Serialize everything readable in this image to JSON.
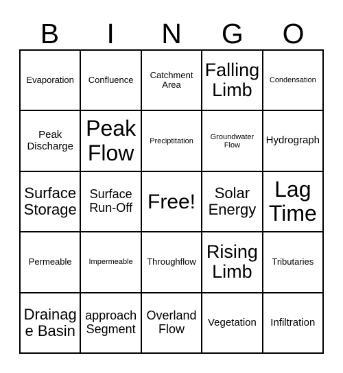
{
  "card": {
    "title": "BINGO",
    "header_letters": [
      "B",
      "I",
      "N",
      "G",
      "O"
    ],
    "columns": 5,
    "rows": 5,
    "colors": {
      "background": "#ffffff",
      "text": "#000000",
      "border": "#000000"
    },
    "free_space_label": "Free!",
    "free_space_position": {
      "row": 3,
      "column": 3
    },
    "cells": [
      [
        {
          "label": "Evaporation",
          "size": "sm"
        },
        {
          "label": "Confluence",
          "size": "sm"
        },
        {
          "label": "Catchment Area",
          "size": "sm"
        },
        {
          "label": "Falling Limb",
          "size": "2xl"
        },
        {
          "label": "Condensation",
          "size": "xs"
        }
      ],
      [
        {
          "label": "Peak Discharge",
          "size": "md"
        },
        {
          "label": "Peak Flow",
          "size": "4xl"
        },
        {
          "label": "Preciptitation",
          "size": "xs"
        },
        {
          "label": "Groundwater Flow",
          "size": "xs"
        },
        {
          "label": "Hydrograph",
          "size": "md"
        }
      ],
      [
        {
          "label": "Surface Storage",
          "size": "xl"
        },
        {
          "label": "Surface Run-Off",
          "size": "lg"
        },
        {
          "label": "Free!",
          "size": "3xl"
        },
        {
          "label": "Solar Energy",
          "size": "xl"
        },
        {
          "label": "Lag Time",
          "size": "4xl"
        }
      ],
      [
        {
          "label": "Permeable",
          "size": "sm"
        },
        {
          "label": "Impermeable",
          "size": "xs"
        },
        {
          "label": "Throughflow",
          "size": "sm"
        },
        {
          "label": "Rising Limb",
          "size": "2xl"
        },
        {
          "label": "Tributaries",
          "size": "sm"
        }
      ],
      [
        {
          "label": "Drainage Basin",
          "size": "xl"
        },
        {
          "label": "approach Segment",
          "size": "lg"
        },
        {
          "label": "Overland Flow",
          "size": "lg"
        },
        {
          "label": "Vegetation",
          "size": "md"
        },
        {
          "label": "Infiltration",
          "size": "md"
        }
      ]
    ]
  }
}
